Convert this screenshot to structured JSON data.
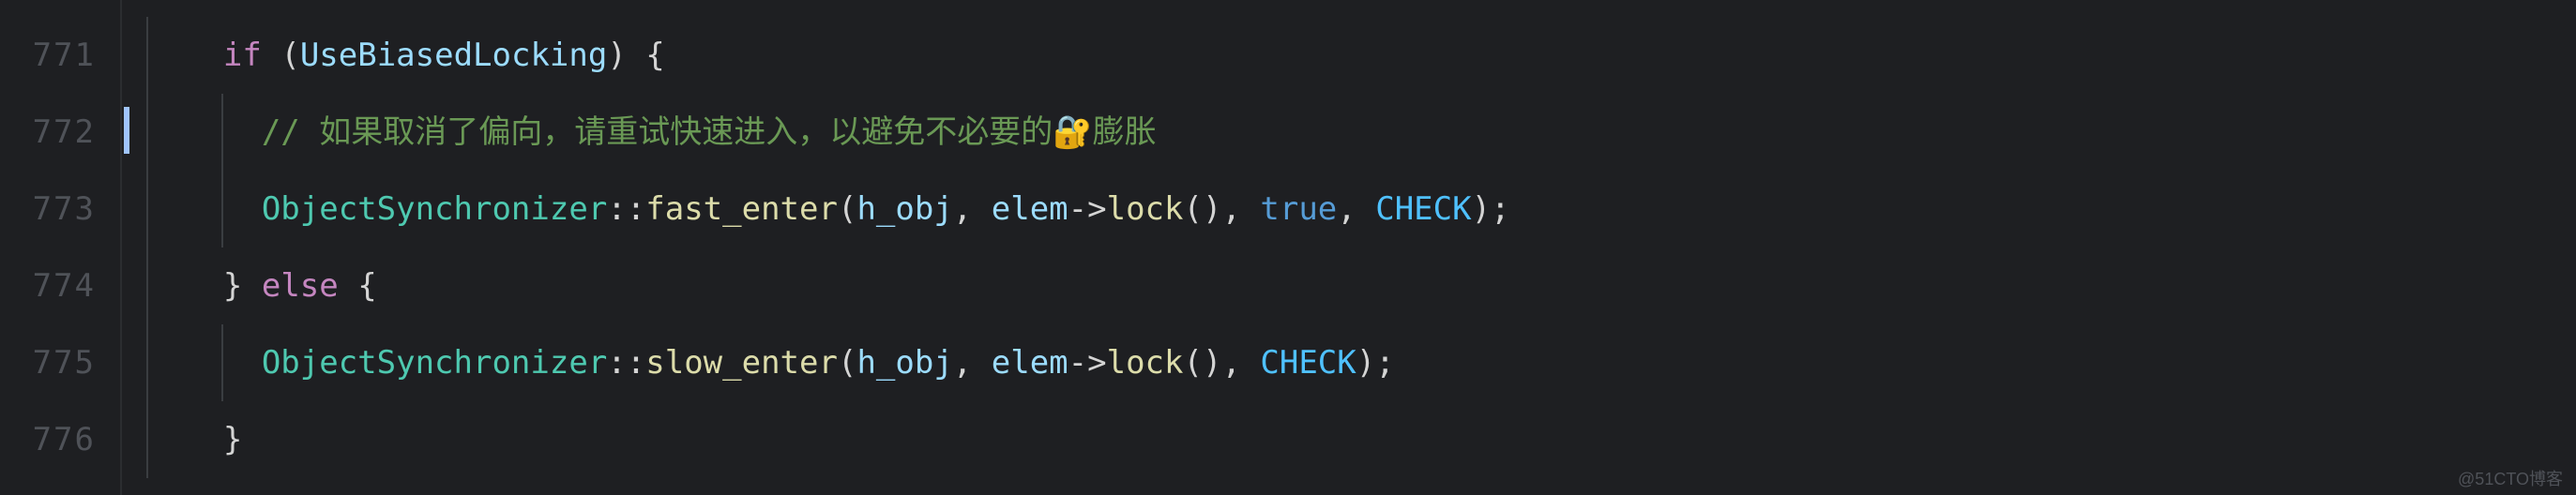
{
  "gutter": {
    "lines": [
      "771",
      "772",
      "773",
      "774",
      "775",
      "776"
    ]
  },
  "code": {
    "l1": {
      "indent": "    ",
      "kw": "if",
      "sp": " ",
      "po": "(",
      "id": "UseBiasedLocking",
      "pc": ")",
      "sp2": " ",
      "br": "{"
    },
    "l2": {
      "indent": "      ",
      "comment": "// 如果取消了偏向，请重试快速进入，以避免不必要的🔐膨胀"
    },
    "l3": {
      "indent": "      ",
      "type": "ObjectSynchronizer",
      "sep": "::",
      "fn": "fast_enter",
      "po": "(",
      "a1": "h_obj",
      "c1": ", ",
      "a2": "elem",
      "arrow": "->",
      "a2fn": "lock",
      "a2paren": "()",
      "c2": ", ",
      "a3": "true",
      "c3": ", ",
      "a4": "CHECK",
      "pc": ")",
      "semi": ";"
    },
    "l4": {
      "indent": "    ",
      "cb": "}",
      "sp": " ",
      "kw": "else",
      "sp2": " ",
      "ob": "{"
    },
    "l5": {
      "indent": "      ",
      "type": "ObjectSynchronizer",
      "sep": "::",
      "fn": "slow_enter",
      "po": "(",
      "a1": "h_obj",
      "c1": ", ",
      "a2": "elem",
      "arrow": "->",
      "a2fn": "lock",
      "a2paren": "()",
      "c2": ", ",
      "a4": "CHECK",
      "pc": ")",
      "semi": ";"
    },
    "l6": {
      "indent": "    ",
      "cb": "}"
    }
  },
  "watermark": "@51CTO博客",
  "colors": {
    "bg": "#1e1f22",
    "gutter_fg": "#4f5258",
    "keyword": "#c586c0",
    "func": "#dcdcaa",
    "ident": "#9cdcfe",
    "type": "#4ec9b0",
    "plain": "#d4d4d4",
    "bool": "#569cd6",
    "const": "#4fc1ff",
    "comment": "#6a9955"
  }
}
